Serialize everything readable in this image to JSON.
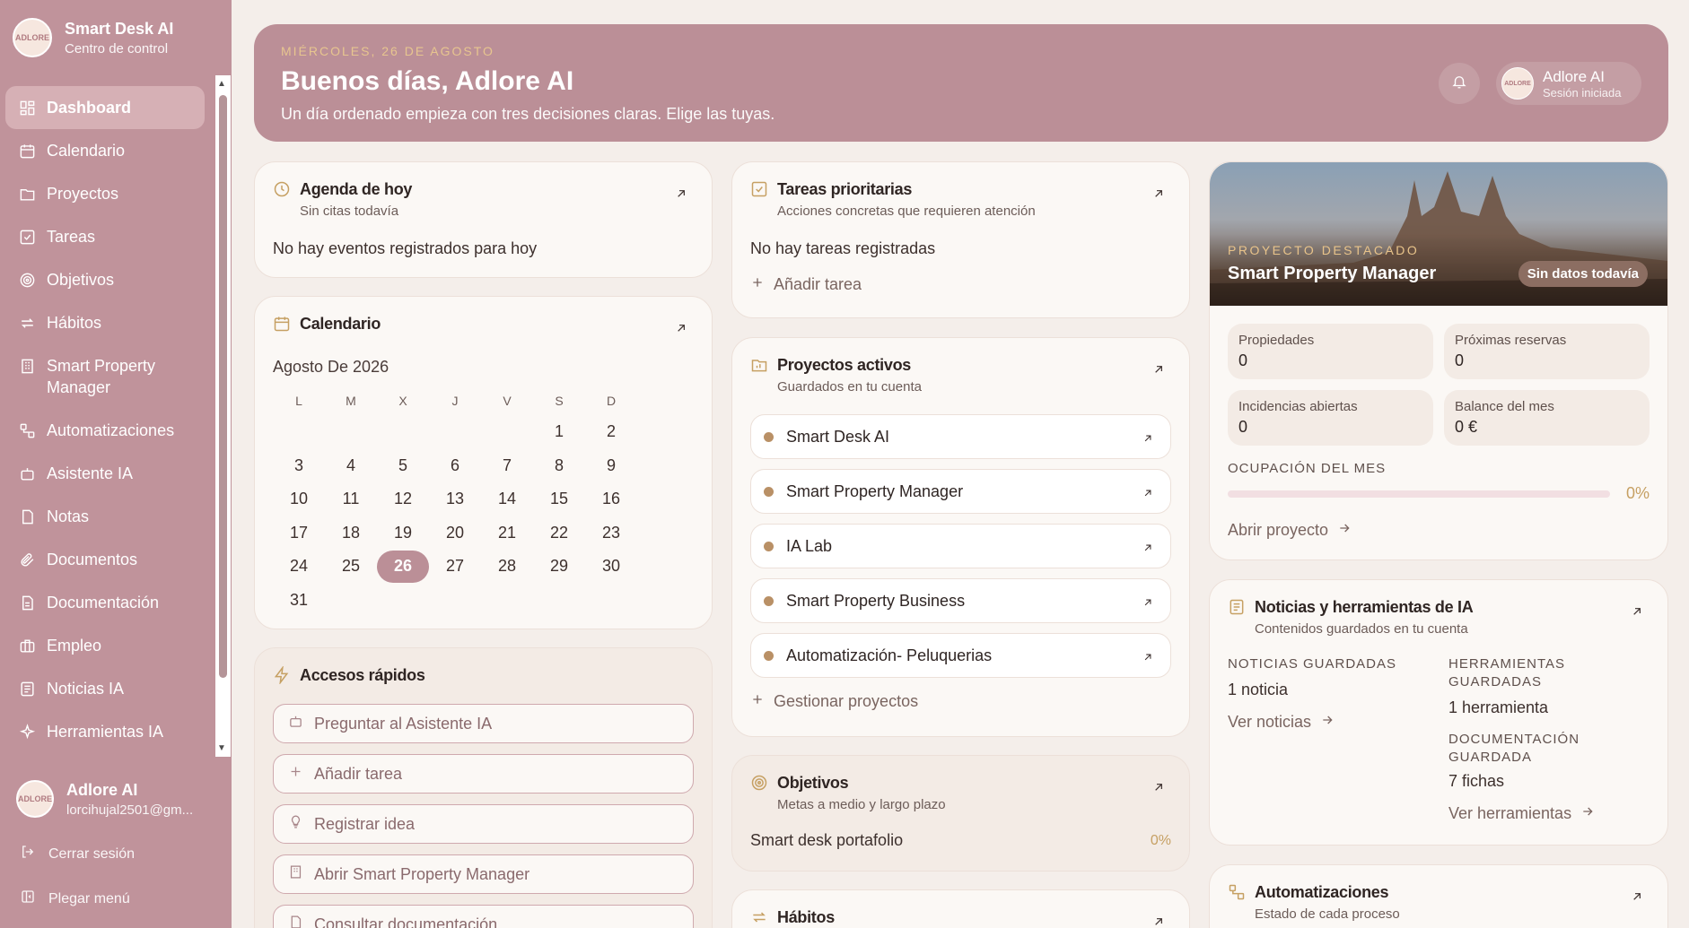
{
  "sidebar": {
    "brand_title": "Smart Desk AI",
    "brand_sub": "Centro de control",
    "avatar_text": "ADLORE",
    "items": [
      {
        "label": "Dashboard",
        "icon": "dashboard-icon"
      },
      {
        "label": "Calendario",
        "icon": "calendar-icon"
      },
      {
        "label": "Proyectos",
        "icon": "folder-icon"
      },
      {
        "label": "Tareas",
        "icon": "checkbox-icon"
      },
      {
        "label": "Objetivos",
        "icon": "target-icon"
      },
      {
        "label": "Hábitos",
        "icon": "repeat-icon"
      },
      {
        "label": "Smart Property Manager",
        "icon": "building-icon"
      },
      {
        "label": "Automatizaciones",
        "icon": "workflow-icon"
      },
      {
        "label": "Asistente IA",
        "icon": "bot-icon"
      },
      {
        "label": "Notas",
        "icon": "note-icon"
      },
      {
        "label": "Documentos",
        "icon": "paperclip-icon"
      },
      {
        "label": "Documentación",
        "icon": "document-icon"
      },
      {
        "label": "Empleo",
        "icon": "briefcase-icon"
      },
      {
        "label": "Noticias IA",
        "icon": "news-icon"
      },
      {
        "label": "Herramientas IA",
        "icon": "sparkles-icon"
      }
    ],
    "user_name": "Adlore AI",
    "user_email": "lorcihujal2501@gm...",
    "logout": "Cerrar sesión",
    "collapse": "Plegar menú"
  },
  "hero": {
    "date": "MIÉRCOLES, 26 DE AGOSTO",
    "title": "Buenos días, Adlore AI",
    "subtitle": "Un día ordenado empieza con tres decisiones claras. Elige las tuyas.",
    "user_name": "Adlore AI",
    "user_status": "Sesión iniciada"
  },
  "agenda": {
    "title": "Agenda de hoy",
    "sub": "Sin citas todavía",
    "empty": "No hay eventos registrados para hoy"
  },
  "calendar": {
    "title": "Calendario",
    "month": "Agosto De 2026",
    "weekdays": [
      "L",
      "M",
      "X",
      "J",
      "V",
      "S",
      "D"
    ],
    "days": [
      "",
      "",
      "",
      "",
      "",
      "1",
      "2",
      "3",
      "4",
      "5",
      "6",
      "7",
      "8",
      "9",
      "10",
      "11",
      "12",
      "13",
      "14",
      "15",
      "16",
      "17",
      "18",
      "19",
      "20",
      "21",
      "22",
      "23",
      "24",
      "25",
      "26",
      "27",
      "28",
      "29",
      "30",
      "31"
    ],
    "today": "26"
  },
  "quick": {
    "title": "Accesos rápidos",
    "items": [
      "Preguntar al Asistente IA",
      "Añadir tarea",
      "Registrar idea",
      "Abrir Smart Property Manager",
      "Consultar documentación"
    ]
  },
  "tasks": {
    "title": "Tareas prioritarias",
    "sub": "Acciones concretas que requieren atención",
    "empty": "No hay tareas registradas",
    "add": "Añadir tarea"
  },
  "projects": {
    "title": "Proyectos activos",
    "sub": "Guardados en tu cuenta",
    "items": [
      "Smart Desk AI",
      "Smart Property Manager",
      "IA Lab",
      "Smart Property Business",
      "Automatización- Peluquerias"
    ],
    "manage": "Gestionar proyectos"
  },
  "goals": {
    "title": "Objetivos",
    "sub": "Metas a medio y largo plazo",
    "item": "Smart desk portafolio",
    "pct": "0%"
  },
  "habits": {
    "title": "Hábitos"
  },
  "featured": {
    "label": "PROYECTO DESTACADO",
    "title": "Smart Property Manager",
    "badge": "Sin datos todavía",
    "stats": [
      {
        "label": "Propiedades",
        "value": "0"
      },
      {
        "label": "Próximas reservas",
        "value": "0"
      },
      {
        "label": "Incidencias abiertas",
        "value": "0"
      },
      {
        "label": "Balance del mes",
        "value": "0 €"
      }
    ],
    "occupancy_label": "OCUPACIÓN DEL MES",
    "occupancy_pct": "0%",
    "occupancy_value": 0,
    "open": "Abrir proyecto"
  },
  "news": {
    "title": "Noticias y herramientas de IA",
    "sub": "Contenidos guardados en tu cuenta",
    "news_label": "NOTICIAS GUARDADAS",
    "news_value": "1 noticia",
    "news_link": "Ver noticias",
    "tools_label": "HERRAMIENTAS GUARDADAS",
    "tools_value": "1 herramienta",
    "docs_label": "DOCUMENTACIÓN GUARDADA",
    "docs_value": "7 fichas",
    "tools_link": "Ver herramientas"
  },
  "automations": {
    "title": "Automatizaciones",
    "sub": "Estado de cada proceso"
  }
}
